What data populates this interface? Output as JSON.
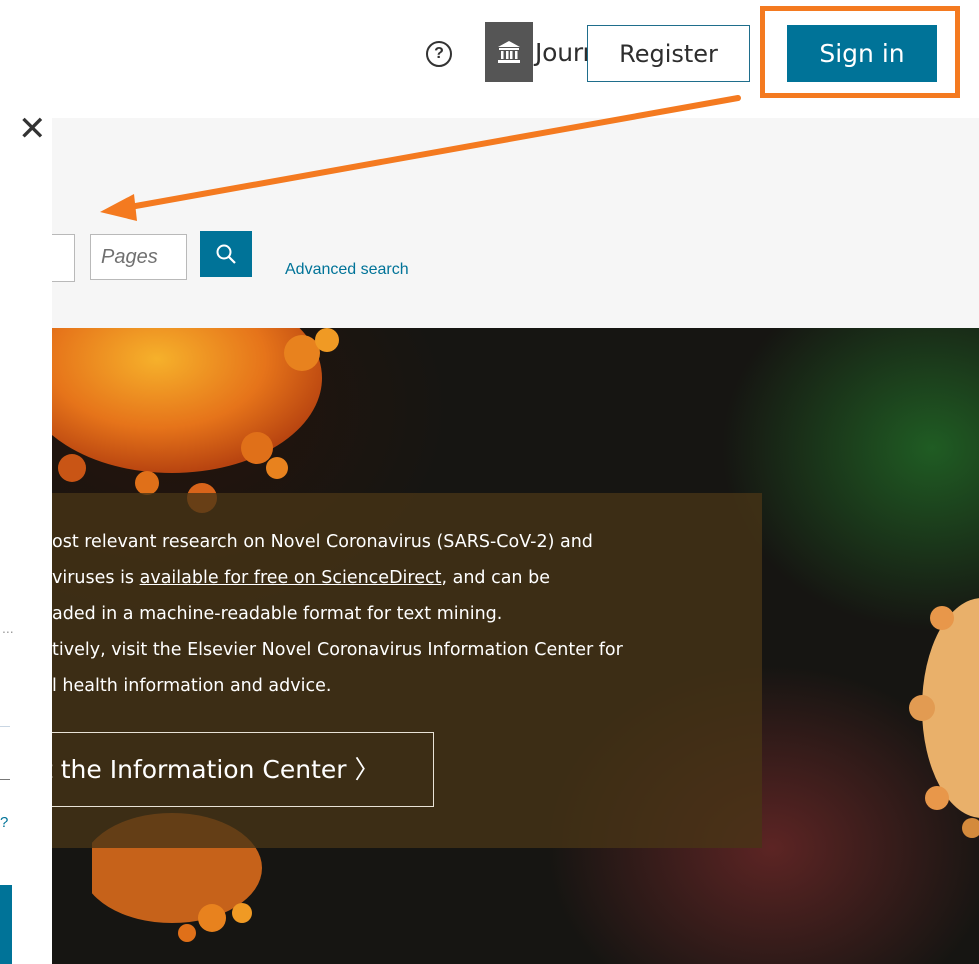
{
  "header": {
    "nav_link": "Journals & Books",
    "help_icon": "?",
    "register_label": "Register",
    "signin_label": "Sign in"
  },
  "panel": {
    "close_icon": "✕",
    "ellipsis": "...",
    "question_char": "?"
  },
  "search": {
    "pages_placeholder": "Pages",
    "advanced_link": "Advanced search"
  },
  "hero": {
    "lines": [
      "ost relevant research on Novel Coronavirus (SARS-CoV-2) and",
      "viruses is ",
      "available for free on ScienceDirect",
      ", and can be",
      "aded in a machine-readable format for text mining.",
      "tively, visit the Elsevier Novel Coronavirus Information Center for",
      "l health information and advice."
    ],
    "cta_label": "t the Information Center",
    "cta_chevron": "〉"
  },
  "colors": {
    "accent_blue": "#007398",
    "highlight_orange": "#f47a20",
    "hero_overlay": "#48341 6"
  }
}
